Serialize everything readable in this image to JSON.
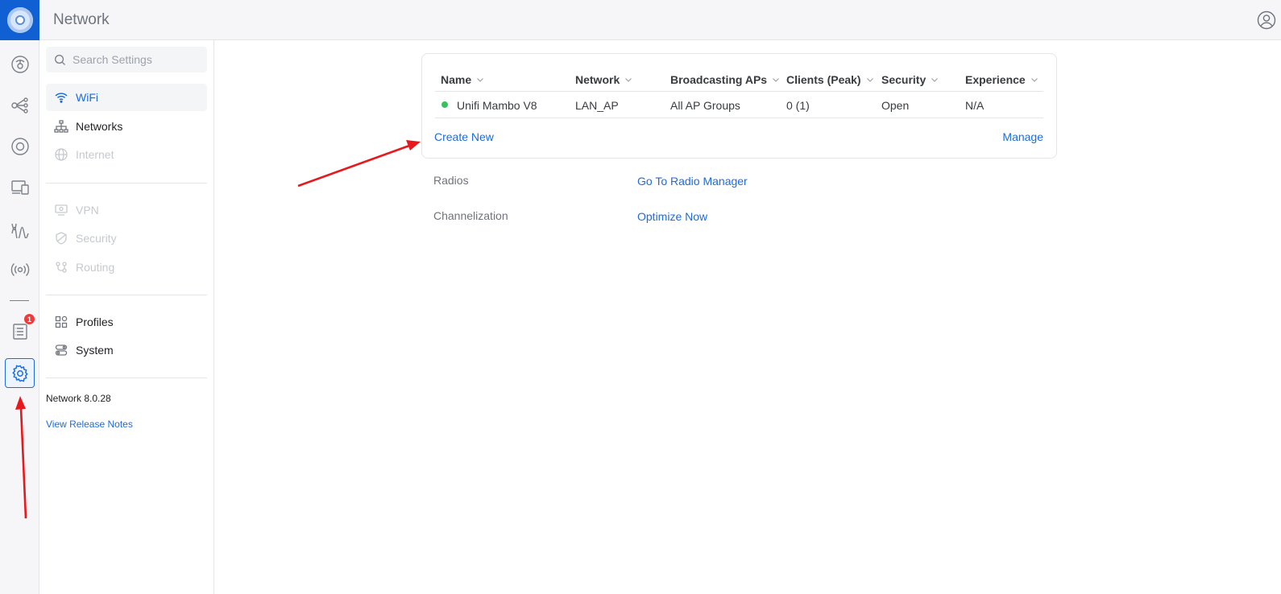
{
  "app": {
    "title": "Network"
  },
  "rail": {
    "items": [
      {
        "icon": "dashboard-icon"
      },
      {
        "icon": "topology-icon"
      },
      {
        "icon": "devices-icon"
      },
      {
        "icon": "clients-icon"
      },
      {
        "icon": "insights-icon"
      },
      {
        "icon": "radios-icon"
      },
      {
        "icon": "alerts-icon",
        "badge": "1"
      },
      {
        "icon": "settings-icon",
        "active": true
      }
    ]
  },
  "sidebar": {
    "search_placeholder": "Search Settings",
    "items": [
      {
        "label": "WiFi",
        "icon": "wifi-icon",
        "state": "selected"
      },
      {
        "label": "Networks",
        "icon": "networks-icon",
        "state": "normal"
      },
      {
        "label": "Internet",
        "icon": "globe-icon",
        "state": "disabled"
      },
      {
        "label": "VPN",
        "icon": "vpn-icon",
        "state": "disabled"
      },
      {
        "label": "Security",
        "icon": "shield-icon",
        "state": "disabled"
      },
      {
        "label": "Routing",
        "icon": "routing-icon",
        "state": "disabled"
      },
      {
        "label": "Profiles",
        "icon": "profiles-icon",
        "state": "normal"
      },
      {
        "label": "System",
        "icon": "system-icon",
        "state": "normal"
      }
    ],
    "version": "Network 8.0.28",
    "release_notes": "View Release Notes"
  },
  "wifi_table": {
    "columns": [
      "Name",
      "Network",
      "Broadcasting APs",
      "Clients (Peak)",
      "Security",
      "Experience"
    ],
    "rows": [
      {
        "name": "Unifi Mambo V8",
        "network": "LAN_AP",
        "aps": "All AP Groups",
        "clients": "0 (1)",
        "security": "Open",
        "experience": "N/A",
        "status": "online"
      }
    ],
    "create_new": "Create New",
    "manage": "Manage"
  },
  "extras": {
    "radios_label": "Radios",
    "radios_link": "Go To Radio Manager",
    "channel_label": "Channelization",
    "channel_link": "Optimize Now"
  },
  "colors": {
    "accent": "#1c6ce0",
    "brand": "#1160d3",
    "online": "#38c25d",
    "badge": "#ee3b3b",
    "annotation": "#e8191c"
  }
}
